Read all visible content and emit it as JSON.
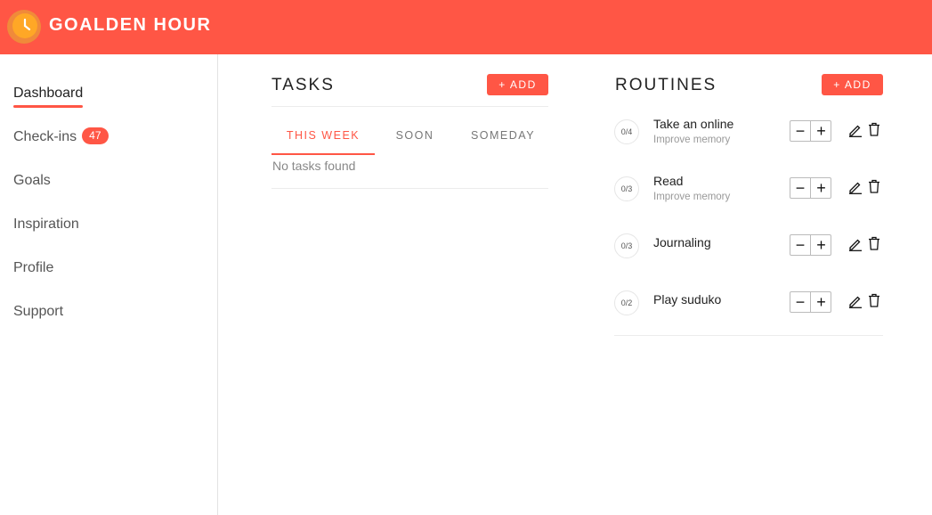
{
  "app": {
    "title": "GOALDEN HOUR",
    "logo_icon": "clock-icon"
  },
  "sidebar": {
    "items": [
      {
        "label": "Dashboard",
        "active": true
      },
      {
        "label": "Check-ins",
        "badge": "47"
      },
      {
        "label": "Goals"
      },
      {
        "label": "Inspiration"
      },
      {
        "label": "Profile"
      },
      {
        "label": "Support"
      }
    ]
  },
  "tasks": {
    "title": "TASKS",
    "add_label": "+ ADD",
    "tabs": [
      {
        "label": "THIS WEEK",
        "active": true
      },
      {
        "label": "SOON"
      },
      {
        "label": "SOMEDAY"
      }
    ],
    "empty_text": "No tasks found"
  },
  "routines": {
    "title": "ROUTINES",
    "add_label": "+ ADD",
    "items": [
      {
        "counter": "0/4",
        "name": "Take an online",
        "goal": "Improve memory"
      },
      {
        "counter": "0/3",
        "name": "Read",
        "goal": "Improve memory"
      },
      {
        "counter": "0/3",
        "name": "Journaling",
        "goal": ""
      },
      {
        "counter": "0/2",
        "name": "Play suduko",
        "goal": ""
      }
    ],
    "stepper": {
      "minus": "−",
      "plus": "+"
    }
  },
  "colors": {
    "accent": "#ff5645",
    "logo_outer": "#ffa726",
    "logo_inner": "#ff9800"
  }
}
